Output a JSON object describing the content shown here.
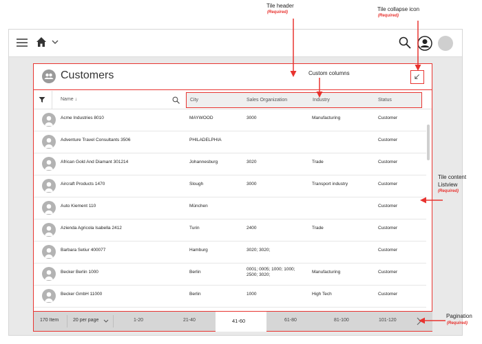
{
  "annotations": {
    "tile_header": "Tile header",
    "tile_header_req": "(Required)",
    "tile_collapse": "Tile collapse icon",
    "tile_collapse_req": "(Required)",
    "custom_columns": "Custom columns",
    "tile_content_1": "Tile content",
    "tile_content_2": "Listview",
    "tile_content_req": "(Required)",
    "pagination": "Pagination",
    "pagination_req": "(Required)"
  },
  "tile": {
    "title": "Customers"
  },
  "columns": {
    "name": "Name ↓",
    "city": "City",
    "sales_org": "Sales Organization",
    "industry": "Industry",
    "status": "Status"
  },
  "rows": [
    {
      "name": "Acme Industries 8010",
      "city": "MAYWOOD",
      "sales": "3000",
      "industry": "Manufacturing",
      "status": "Customer"
    },
    {
      "name": "Adventure Travel Consultants 3506",
      "city": "PHILADELPHIA",
      "sales": "",
      "industry": "",
      "status": "Customer"
    },
    {
      "name": "African Gold And Diamant 301214",
      "city": "Johannesburg",
      "sales": "3020",
      "industry": "Trade",
      "status": "Customer"
    },
    {
      "name": "Aircraft Products 1470",
      "city": "Slough",
      "sales": "3000",
      "industry": "Transport industry",
      "status": "Customer"
    },
    {
      "name": "Auto Kiement 110",
      "city": "München",
      "sales": "",
      "industry": "",
      "status": "Customer"
    },
    {
      "name": "Azienda Agricola Isabella 2412",
      "city": "Turin",
      "sales": "2400",
      "industry": "Trade",
      "status": "Customer"
    },
    {
      "name": "Barbara Setiur 400077",
      "city": "Hamburg",
      "sales": "3020; 3020;",
      "industry": "",
      "status": "Customer"
    },
    {
      "name": "Becker Berlin 1000",
      "city": "Berlin",
      "sales": "0001; 0005; 1000; 1000; 2500; 3020;",
      "industry": "Manufacturing",
      "status": "Customer"
    },
    {
      "name": "Becker GmbH 11000",
      "city": "Berlin",
      "sales": "1000",
      "industry": "High Tech",
      "status": "Customer"
    }
  ],
  "pagination": {
    "items": "170 Item",
    "per_page": "20 per page",
    "pages": [
      "1-20",
      "21-40",
      "41-60",
      "61-80",
      "81-100",
      "101-120"
    ],
    "active": "41-60"
  },
  "colors": {
    "accent": "#e8332f",
    "header_bg": "#efefef",
    "pager_bg": "#d6d6d6"
  }
}
